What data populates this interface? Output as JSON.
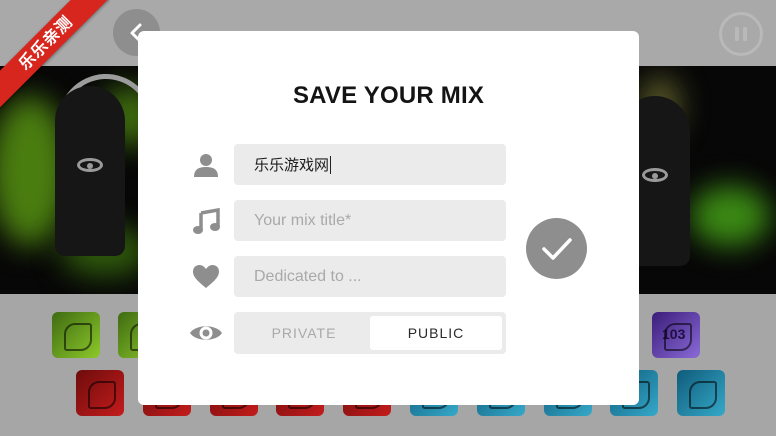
{
  "watermark": {
    "text": "乐乐亲测"
  },
  "modal": {
    "title": "SAVE YOUR MIX",
    "fields": {
      "author": {
        "value": "乐乐游戏网",
        "icon": "user-icon"
      },
      "mix_title": {
        "placeholder": "Your mix title*",
        "icon": "music-note-icon"
      },
      "dedicated": {
        "placeholder": "Dedicated to ...",
        "icon": "heart-icon"
      }
    },
    "visibility": {
      "icon": "eye-icon",
      "options": [
        "PRIVATE",
        "PUBLIC"
      ],
      "selected": "PUBLIC"
    },
    "confirm_icon": "checkmark-icon"
  },
  "background": {
    "back_icon": "back-arrow-icon",
    "pause_icon": "pause-icon",
    "beat_label": "103"
  },
  "colors": {
    "modal_bg": "#ffffff",
    "field_bg": "#ebebeb",
    "icon_gray": "#8e8e8e",
    "title": "#141414",
    "ribbon": "#d7261e"
  }
}
